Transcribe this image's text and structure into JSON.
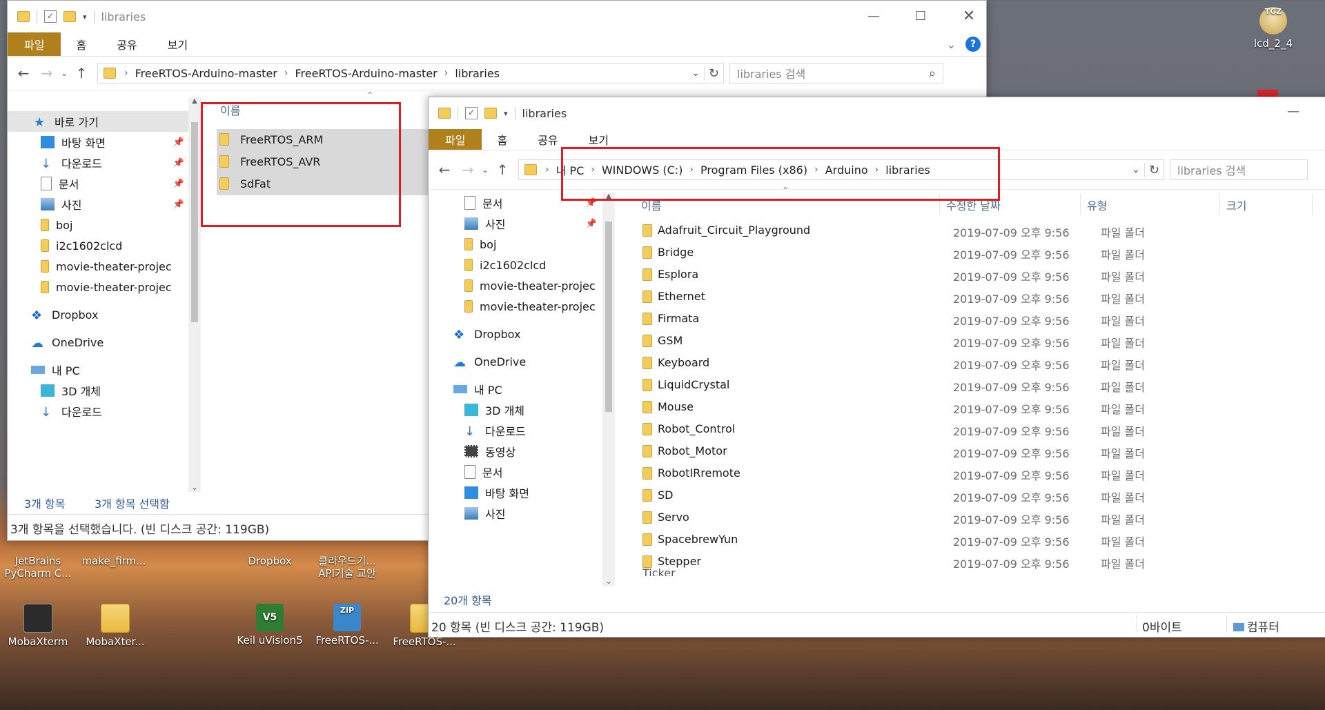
{
  "desktop": {
    "icons": [
      {
        "label": "lcd_2_4",
        "badge": "TGZ"
      },
      {
        "label": "JetBrains PyCharm C..."
      },
      {
        "label": "make_firm..."
      },
      {
        "label": "Dropbox"
      },
      {
        "label": "클라우드기... API기술 교안"
      },
      {
        "label": "MobaXterm"
      },
      {
        "label": "MobaXter..."
      },
      {
        "label": "Keil uVision5",
        "badge": "V5"
      },
      {
        "label": "FreeRTOS-...",
        "badge": "ZIP"
      },
      {
        "label": "FreeRTOS-..."
      }
    ]
  },
  "back_window": {
    "title": "libraries",
    "tabs": {
      "file": "파일",
      "home": "홈",
      "share": "공유",
      "view": "보기"
    },
    "breadcrumbs": [
      "FreeRTOS-Arduino-master",
      "FreeRTOS-Arduino-master",
      "libraries"
    ],
    "search_placeholder": "libraries 검색",
    "nav": {
      "quick_access": "바로 가기",
      "items": [
        {
          "label": "바탕 화면",
          "pinned": true
        },
        {
          "label": "다운로드",
          "pinned": true
        },
        {
          "label": "문서",
          "pinned": true
        },
        {
          "label": "사진",
          "pinned": true
        },
        {
          "label": "boj"
        },
        {
          "label": "i2c1602clcd"
        },
        {
          "label": "movie-theater-projec"
        },
        {
          "label": "movie-theater-projec"
        }
      ],
      "dropbox": "Dropbox",
      "onedrive": "OneDrive",
      "thispc": "내 PC",
      "pc_items": [
        {
          "label": "3D 개체"
        },
        {
          "label": "다운로드"
        }
      ]
    },
    "column_name": "이름",
    "files": [
      "FreeRTOS_ARM",
      "FreeRTOS_AVR",
      "SdFat"
    ],
    "status_count": "3개 항목",
    "status_selected": "3개 항목 선택함",
    "bottom_status": "3개 항목을 선택했습니다. (빈 디스크 공간: 119GB)"
  },
  "front_window": {
    "title": "libraries",
    "tabs": {
      "file": "파일",
      "home": "홈",
      "share": "공유",
      "view": "보기"
    },
    "breadcrumbs": [
      "내 PC",
      "WINDOWS (C:)",
      "Program Files (x86)",
      "Arduino",
      "libraries"
    ],
    "search_placeholder": "libraries 검색",
    "nav": {
      "items": [
        {
          "label": "문서",
          "pinned": true
        },
        {
          "label": "사진",
          "pinned": true
        },
        {
          "label": "boj"
        },
        {
          "label": "i2c1602clcd"
        },
        {
          "label": "movie-theater-projec"
        },
        {
          "label": "movie-theater-projec"
        }
      ],
      "dropbox": "Dropbox",
      "onedrive": "OneDrive",
      "thispc": "내 PC",
      "pc_items": [
        {
          "label": "3D 개체"
        },
        {
          "label": "다운로드"
        },
        {
          "label": "동영상"
        },
        {
          "label": "문서"
        },
        {
          "label": "바탕 화면"
        },
        {
          "label": "사진"
        }
      ]
    },
    "columns": {
      "name": "이름",
      "modified": "수정한 날짜",
      "type": "유형",
      "size": "크기"
    },
    "files": [
      {
        "name": "Adafruit_Circuit_Playground",
        "date": "2019-07-09 오후 9:56",
        "type": "파일 폴더"
      },
      {
        "name": "Bridge",
        "date": "2019-07-09 오후 9:56",
        "type": "파일 폴더"
      },
      {
        "name": "Esplora",
        "date": "2019-07-09 오후 9:56",
        "type": "파일 폴더"
      },
      {
        "name": "Ethernet",
        "date": "2019-07-09 오후 9:56",
        "type": "파일 폴더"
      },
      {
        "name": "Firmata",
        "date": "2019-07-09 오후 9:56",
        "type": "파일 폴더"
      },
      {
        "name": "GSM",
        "date": "2019-07-09 오후 9:56",
        "type": "파일 폴더"
      },
      {
        "name": "Keyboard",
        "date": "2019-07-09 오후 9:56",
        "type": "파일 폴더"
      },
      {
        "name": "LiquidCrystal",
        "date": "2019-07-09 오후 9:56",
        "type": "파일 폴더"
      },
      {
        "name": "Mouse",
        "date": "2019-07-09 오후 9:56",
        "type": "파일 폴더"
      },
      {
        "name": "Robot_Control",
        "date": "2019-07-09 오후 9:56",
        "type": "파일 폴더"
      },
      {
        "name": "Robot_Motor",
        "date": "2019-07-09 오후 9:56",
        "type": "파일 폴더"
      },
      {
        "name": "RobotIRremote",
        "date": "2019-07-09 오후 9:56",
        "type": "파일 폴더"
      },
      {
        "name": "SD",
        "date": "2019-07-09 오후 9:56",
        "type": "파일 폴더"
      },
      {
        "name": "Servo",
        "date": "2019-07-09 오후 9:56",
        "type": "파일 폴더"
      },
      {
        "name": "SpacebrewYun",
        "date": "2019-07-09 오후 9:56",
        "type": "파일 폴더"
      },
      {
        "name": "Stepper",
        "date": "2019-07-09 오후 9:56",
        "type": "파일 폴더"
      }
    ],
    "status_count": "20개 항목",
    "bottom_status": "20 항목 (빈 디스크 공간: 119GB)",
    "bottom_size": "0바이트",
    "bottom_computer": "컴퓨터"
  }
}
